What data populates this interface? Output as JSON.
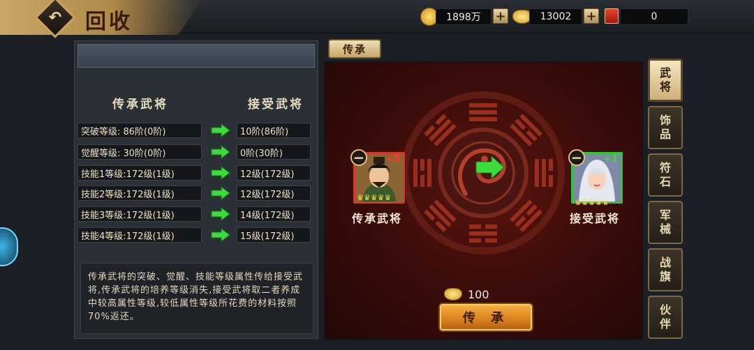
{
  "header": {
    "title": "回收",
    "back_icon": "back-arrow-icon",
    "resources": [
      {
        "icon": "gold-coin-icon",
        "value": "1898万",
        "has_plus": true
      },
      {
        "icon": "ingot-icon",
        "value": "13002",
        "has_plus": true
      },
      {
        "icon": "scroll-icon",
        "value": "0",
        "has_plus": false
      }
    ]
  },
  "left": {
    "col_from": "传承武将",
    "col_to": "接受武将",
    "rows": [
      {
        "from": "突破等级:  86阶(0阶)",
        "to": "10阶(86阶)"
      },
      {
        "from": "觉醒等级:  30阶(0阶)",
        "to": "0阶(30阶)"
      },
      {
        "from": "技能1等级:172级(1级)",
        "to": "12级(172级)"
      },
      {
        "from": "技能2等级:172级(1级)",
        "to": "12级(172级)"
      },
      {
        "from": "技能3等级:172级(1级)",
        "to": "14级(172级)"
      },
      {
        "from": "技能4等级:172级(1级)",
        "to": "15级(172级)"
      }
    ],
    "description": "传承武将的突破、觉醒、技能等级属性传给接受武将,传承武将的培养等级消失,接受武将取二者养成中较高属性等级,较低属性等级所花费的材料按照70%返还。"
  },
  "stage": {
    "tab_label": "传承",
    "left_hero": {
      "name": "传承武将",
      "level": "+5",
      "stars": 5
    },
    "right_hero": {
      "name": "接受武将",
      "level": "+1",
      "stars": 5
    },
    "cost_value": "100",
    "action_label": "传 承"
  },
  "side_tabs": [
    {
      "line1": "武",
      "line2": "将",
      "active": true
    },
    {
      "line1": "饰",
      "line2": "品",
      "active": false
    },
    {
      "line1": "符",
      "line2": "石",
      "active": false
    },
    {
      "line1": "军",
      "line2": "械",
      "active": false
    },
    {
      "line1": "战",
      "line2": "旗",
      "active": false
    },
    {
      "line1": "伙",
      "line2": "伴",
      "active": false
    }
  ],
  "colors": {
    "accent_gold": "#c9a35c",
    "stage_red": "#5a1410",
    "arrow_green": "#3ddc3d",
    "left_hero_frame": "#d23a2a",
    "right_hero_frame": "#36c23a"
  }
}
